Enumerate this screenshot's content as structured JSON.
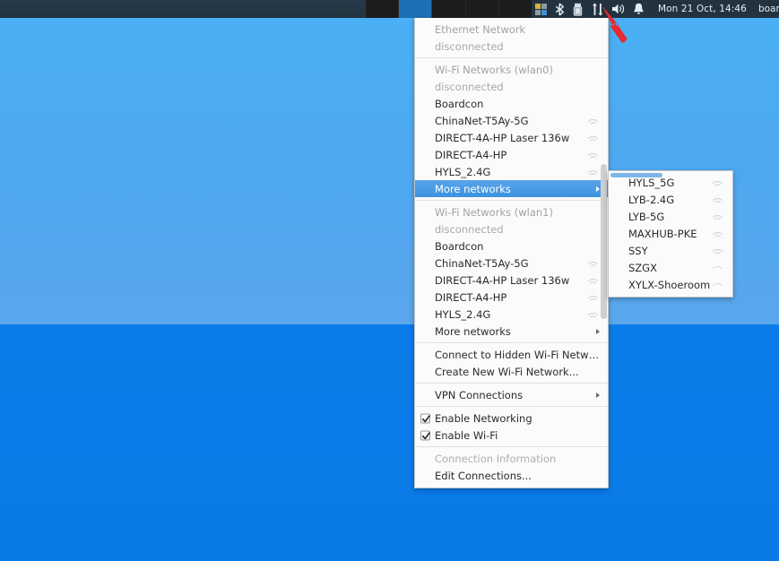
{
  "panel": {
    "clock": "Mon 21 Oct, 14:46",
    "username": "boardcon",
    "workspaces": [
      {
        "name": "workspace-1",
        "active": false
      },
      {
        "name": "workspace-2",
        "active": true
      },
      {
        "name": "workspace-3",
        "active": false
      },
      {
        "name": "workspace-4",
        "active": false
      },
      {
        "name": "workspace-5",
        "active": false
      }
    ],
    "tray_icons": [
      "workspace-grid-icon",
      "bluetooth-icon",
      "usb-drive-icon",
      "network-updown-icon",
      "volume-icon",
      "notification-bell-icon"
    ],
    "colors": {
      "panel_bg": "#22333f",
      "text": "#e8edf1",
      "workspace_active": "#1f6fb5"
    }
  },
  "desktop": {
    "colors": {
      "sky_top": "#49b0f5",
      "sky_bottom": "#5aa6ec",
      "sea": "#0a7ce9"
    }
  },
  "annotation": {
    "arrow_color": "#e8292f",
    "points_at": "network-updown-icon"
  },
  "network_menu": {
    "sections": [
      {
        "id": "ethernet",
        "header": "Ethernet Network",
        "status": "disconnected",
        "items": []
      },
      {
        "id": "wlan0",
        "header": "Wi-Fi Networks (wlan0)",
        "status": "disconnected",
        "items": [
          {
            "label": "Boardcon",
            "signal": 0
          },
          {
            "label": "ChinaNet-T5Ay-5G",
            "signal": 2
          },
          {
            "label": "DIRECT-4A-HP Laser 136w",
            "signal": 2
          },
          {
            "label": "DIRECT-A4-HP",
            "signal": 2
          },
          {
            "label": "HYLS_2.4G",
            "signal": 2
          }
        ],
        "more": "More networks",
        "more_highlighted": true
      },
      {
        "id": "wlan1",
        "header": "Wi-Fi Networks (wlan1)",
        "status": "disconnected",
        "items": [
          {
            "label": "Boardcon",
            "signal": 0
          },
          {
            "label": "ChinaNet-T5Ay-5G",
            "signal": 2
          },
          {
            "label": "DIRECT-4A-HP Laser 136w",
            "signal": 2
          },
          {
            "label": "DIRECT-A4-HP",
            "signal": 2
          },
          {
            "label": "HYLS_2.4G",
            "signal": 2
          }
        ],
        "more": "More networks",
        "more_highlighted": false
      }
    ],
    "actions": [
      {
        "label": "Connect to Hidden Wi-Fi Network...",
        "disabled": false
      },
      {
        "label": "Create New Wi-Fi Network...",
        "disabled": false
      }
    ],
    "vpn": {
      "label": "VPN Connections",
      "has_submenu": true
    },
    "toggles": [
      {
        "label": "Enable Networking",
        "checked": true
      },
      {
        "label": "Enable Wi-Fi",
        "checked": true
      }
    ],
    "footer": [
      {
        "label": "Connection Information",
        "disabled": true
      },
      {
        "label": "Edit Connections...",
        "disabled": false
      }
    ],
    "colors": {
      "bg": "#fbfbfb",
      "border": "#c3c3c3",
      "text": "#2b2b2b",
      "disabled_text": "#a8a8a8",
      "highlight": "#3e92e0",
      "highlight_text": "#ffffff"
    }
  },
  "network_submenu": {
    "title": "More networks",
    "items": [
      {
        "label": "HYLS_5G",
        "signal": 2
      },
      {
        "label": "LYB-2.4G",
        "signal": 2
      },
      {
        "label": "LYB-5G",
        "signal": 2
      },
      {
        "label": "MAXHUB-PKE",
        "signal": 2
      },
      {
        "label": "SSY",
        "signal": 2
      },
      {
        "label": "SZGX",
        "signal": 1
      },
      {
        "label": "XYLX-Shoeroom",
        "signal": 1
      }
    ]
  }
}
